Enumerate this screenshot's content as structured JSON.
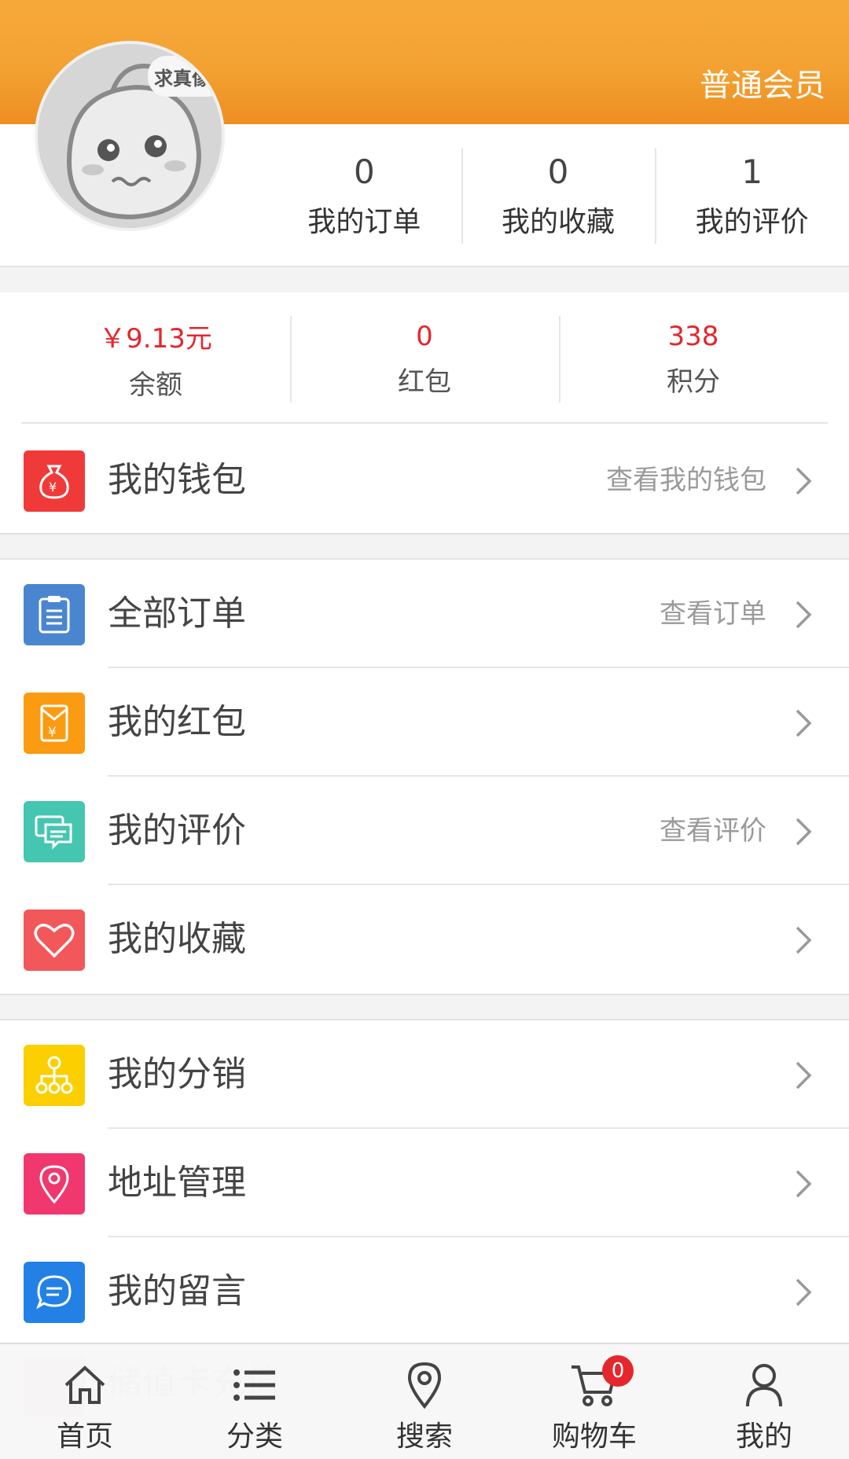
{
  "header": {
    "member_level": "普通会员",
    "avatar_caption": "求真像"
  },
  "stats": [
    {
      "num": "0",
      "label": "我的订单"
    },
    {
      "num": "0",
      "label": "我的收藏"
    },
    {
      "num": "1",
      "label": "我的评价"
    }
  ],
  "assets": [
    {
      "value": "￥9.13元",
      "label": "余额"
    },
    {
      "value": "0",
      "label": "红包"
    },
    {
      "value": "338",
      "label": "积分"
    }
  ],
  "wallet_row": {
    "title": "我的钱包",
    "hint": "查看我的钱包",
    "icon": "money-bag-icon",
    "color": "#f03a3a"
  },
  "orders_section": [
    {
      "title": "全部订单",
      "hint": "查看订单",
      "icon": "clipboard-icon",
      "color": "#4a86d0"
    },
    {
      "title": "我的红包",
      "hint": "",
      "icon": "red-envelope-icon",
      "color": "#fb9b12"
    },
    {
      "title": "我的评价",
      "hint": "查看评价",
      "icon": "comments-icon",
      "color": "#45c6b0"
    },
    {
      "title": "我的收藏",
      "hint": "",
      "icon": "heart-icon",
      "color": "#f2575a"
    }
  ],
  "more_section": [
    {
      "title": "我的分销",
      "icon": "distribution-icon",
      "color": "#fbcf00"
    },
    {
      "title": "地址管理",
      "icon": "location-pin-icon",
      "color": "#f0386f"
    },
    {
      "title": "我的留言",
      "icon": "message-icon",
      "color": "#2381e6"
    }
  ],
  "hidden_row": {
    "title": "储值卡充值",
    "icon_char": "充"
  },
  "tabbar": [
    {
      "label": "首页",
      "icon": "home-icon"
    },
    {
      "label": "分类",
      "icon": "list-icon"
    },
    {
      "label": "搜索",
      "icon": "location-icon"
    },
    {
      "label": "购物车",
      "icon": "cart-icon",
      "badge": "0"
    },
    {
      "label": "我的",
      "icon": "user-icon"
    }
  ]
}
